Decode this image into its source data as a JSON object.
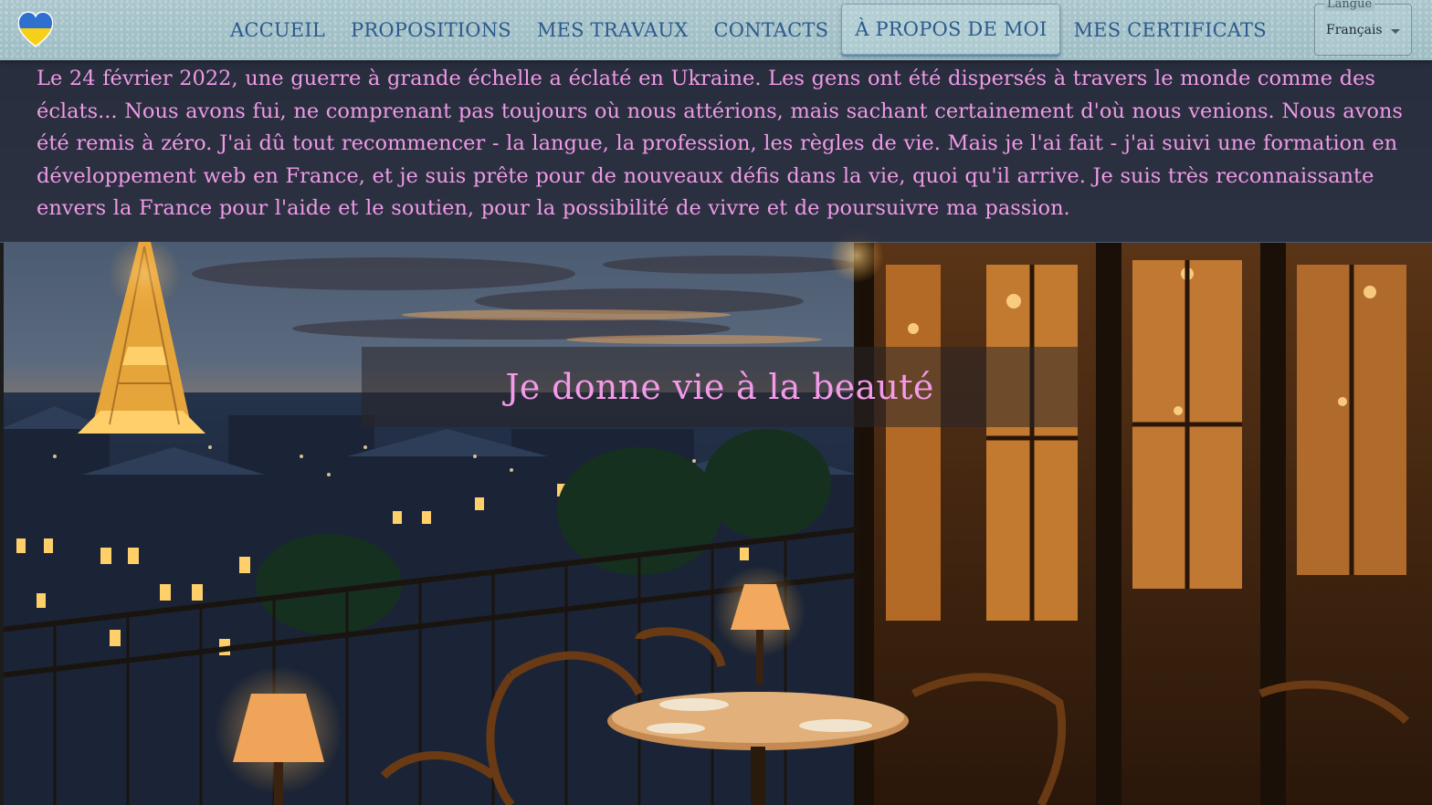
{
  "logo": {
    "icon": "ukraine-heart-icon",
    "colors": [
      "#2f6fd0",
      "#f6cf19"
    ]
  },
  "nav": {
    "items": [
      {
        "label": "ACCUEIL"
      },
      {
        "label": "PROPOSITIONS"
      },
      {
        "label": "MES TRAVAUX"
      },
      {
        "label": "CONTACTS"
      },
      {
        "label": "À PROPOS DE MOI",
        "active": true
      },
      {
        "label": "MES CERTIFICATS"
      }
    ]
  },
  "language": {
    "label": "Langue",
    "value": "Français"
  },
  "intro": {
    "text": "Le 24 février 2022, une guerre à grande échelle a éclaté en Ukraine. Les gens ont été dispersés à travers le monde comme des éclats... Nous avons fui, ne comprenant pas toujours où nous attérions, mais sachant certainement d'où nous venions. Nous avons été remis à zéro. J'ai dû tout recommencer - la langue, la profession, les règles de vie. Mais je l'ai fait - j'ai suivi une formation en développement web en France, et je suis prête pour de nouveaux défis dans la vie, quoi qu'il arrive. Je suis très reconnaissante envers la France pour l'aide et le soutien, pour la possibilité de vivre et de poursuivre ma passion."
  },
  "hero": {
    "tagline": "Je donne vie à la beauté"
  },
  "colors": {
    "accent_text": "#f39ae9",
    "nav_text": "#2c5a8c",
    "header_bg": "#a9c6cc"
  }
}
